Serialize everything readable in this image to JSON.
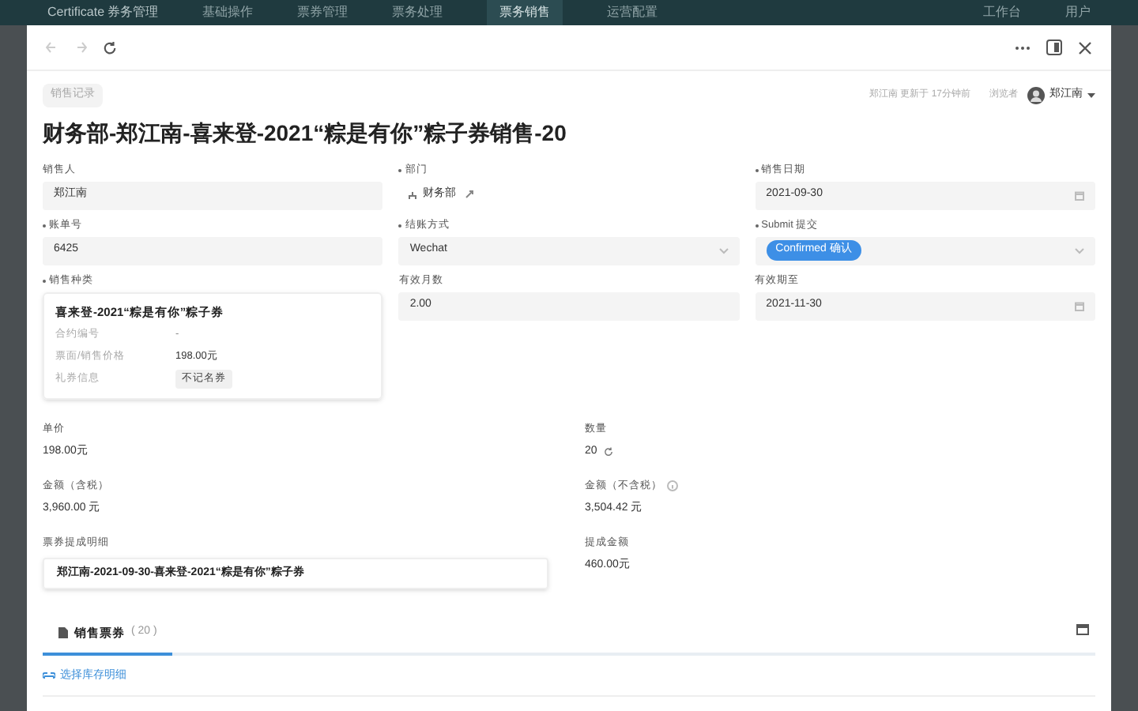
{
  "app_bar": {
    "title": "Certificate 券务管理",
    "menu": [
      {
        "label": "基础操作",
        "selected": false
      },
      {
        "label": "票券管理",
        "selected": false
      },
      {
        "label": "票务处理",
        "selected": false
      },
      {
        "label": "票务销售",
        "selected": true
      },
      {
        "label": "运营配置",
        "selected": false
      }
    ],
    "right_items": [
      "工作台",
      "用户"
    ]
  },
  "modal": {
    "record_tag": "销售记录",
    "title": "财务部-郑江南-喜来登-2021“粽是有你”粽子券销售-20",
    "meta": "郑江南 更新于 17分钟前",
    "viewers": "浏览者",
    "user": "郑江南",
    "fields": [
      {
        "label": "销售人",
        "required": false,
        "kind": "text",
        "value": "郑江南"
      },
      {
        "label": "部门",
        "required": true,
        "kind": "dept",
        "value": "财务部"
      },
      {
        "label": "销售日期",
        "required": true,
        "kind": "date",
        "value": "2021-09-30"
      },
      {
        "label": "账单号",
        "required": true,
        "kind": "text",
        "value": "6425"
      },
      {
        "label": "结账方式",
        "required": true,
        "kind": "select",
        "value": "Wechat"
      },
      {
        "label": "Submit 提交",
        "required": true,
        "kind": "tag",
        "value": "Confirmed 确认"
      },
      {
        "label": "销售种类",
        "required": true,
        "kind": "card",
        "value": "喜来登-2021“粽是有你”粽子券",
        "rows": [
          {
            "label": "合约编号",
            "value": "-",
            "kind": "muted"
          },
          {
            "label": "票面/销售价格",
            "value": "198.00元",
            "kind": "plain"
          },
          {
            "label": "礼券信息",
            "value": "不记名券",
            "kind": "chip"
          }
        ]
      },
      {
        "label": "有效月数",
        "required": false,
        "kind": "text",
        "value": "2.00"
      },
      {
        "label": "有效期至",
        "required": false,
        "kind": "date",
        "value": "2021-11-30"
      }
    ],
    "details": [
      {
        "label": "单价",
        "kind": "plain",
        "value": "198.00元"
      },
      {
        "label": "数量",
        "kind": "refresh",
        "value": "20"
      },
      {
        "label": "金额（含税）",
        "kind": "plain",
        "value": "3,960.00 元"
      },
      {
        "label": "金额（不含税）",
        "kind": "info",
        "value": "3,504.42 元"
      },
      {
        "label": "票券提成明细",
        "kind": "box",
        "value": "郑江南-2021-09-30-喜来登-2021“粽是有你”粽子券"
      },
      {
        "label": "提成金额",
        "kind": "plain",
        "value": "460.00元"
      }
    ],
    "tabs": [
      {
        "label": "销售票券",
        "count": "( 20 )",
        "selected": true
      }
    ],
    "action": "选择库存明细"
  }
}
